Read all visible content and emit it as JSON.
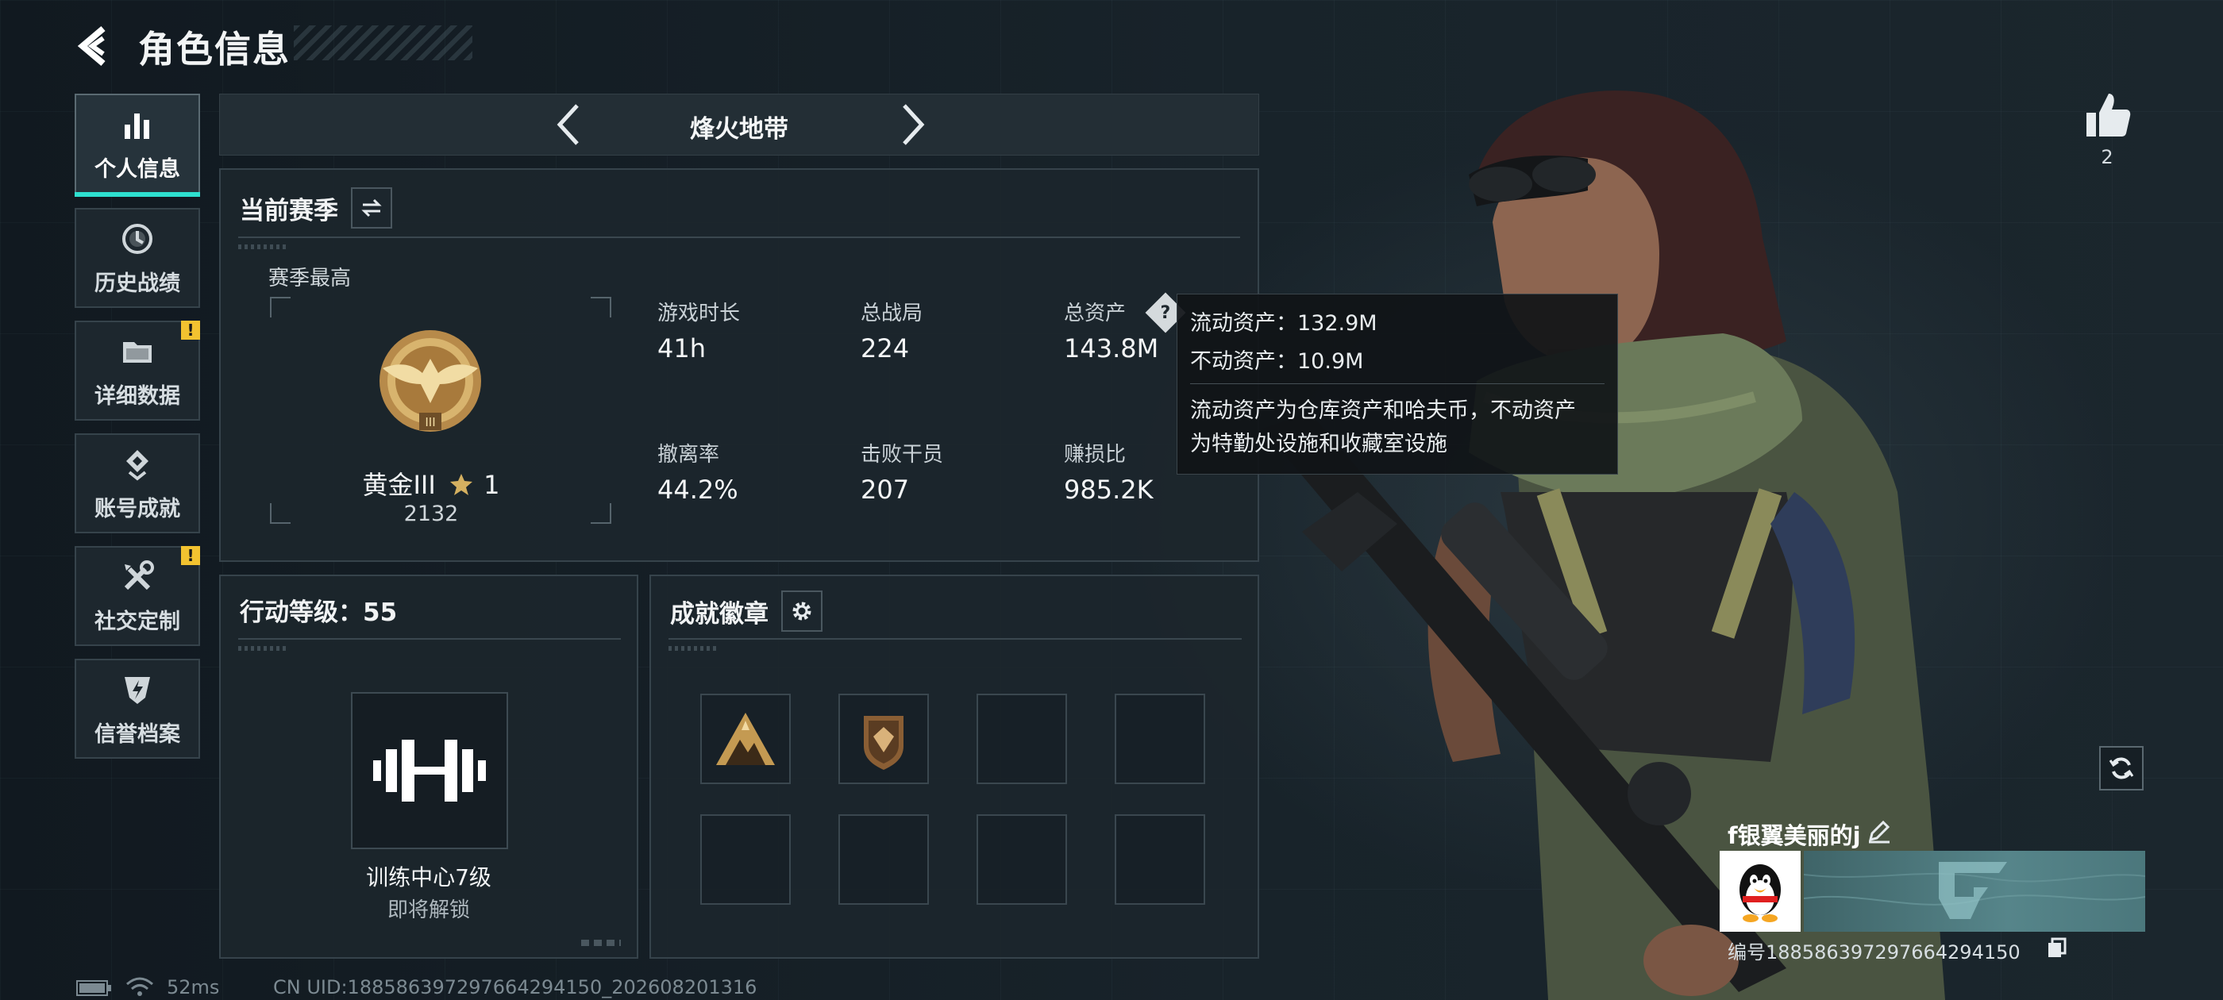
{
  "header": {
    "title": "角色信息",
    "back_icon": "back-arrow-icon"
  },
  "sidebar": {
    "items": [
      {
        "label": "个人信息",
        "icon": "bar-chart-icon",
        "active": true,
        "warning": false
      },
      {
        "label": "历史战绩",
        "icon": "history-clock-icon",
        "active": false,
        "warning": false
      },
      {
        "label": "详细数据",
        "icon": "folder-icon",
        "active": false,
        "warning": true,
        "warning_text": "!"
      },
      {
        "label": "账号成就",
        "icon": "achievement-icon",
        "active": false,
        "warning": false
      },
      {
        "label": "社交定制",
        "icon": "tools-icon",
        "active": false,
        "warning": true,
        "warning_text": "!"
      },
      {
        "label": "信誉档案",
        "icon": "shield-bolt-icon",
        "active": false,
        "warning": false
      }
    ]
  },
  "mode_bar": {
    "title": "烽火地带"
  },
  "season": {
    "title": "当前赛季",
    "subtitle": "赛季最高",
    "rank": {
      "name": "黄金III",
      "stars": "1",
      "score": "2132"
    },
    "stats": [
      {
        "label": "游戏时长",
        "value": "41h"
      },
      {
        "label": "总战局",
        "value": "224"
      },
      {
        "label": "总资产",
        "value": "143.8M"
      },
      {
        "label": "撤离率",
        "value": "44.2%"
      },
      {
        "label": "击败干员",
        "value": "207"
      },
      {
        "label": "赚损比",
        "value": "985.2K"
      }
    ],
    "help_label": "?"
  },
  "tooltip": {
    "liquid": "流动资产：132.9M",
    "fixed": "不动资产：10.9M",
    "note_line1": "流动资产为仓库资产和哈夫币，不动资产",
    "note_line2": "为特勤处设施和收藏室设施"
  },
  "action_level": {
    "title": "行动等级：55",
    "training_name": "训练中心7级",
    "training_status": "即将解锁"
  },
  "badges": {
    "title": "成就徽章",
    "settings_icon": "gear-icon"
  },
  "player": {
    "likes": "2",
    "name": "f银翼美丽的j",
    "id_text": "编号1885863972976642941​50"
  },
  "status_bar": {
    "ping": "52ms",
    "uid": "CN UID:188586397297664294150_202608201316"
  },
  "colors": {
    "accent": "#2ee0d0",
    "warning": "#f2c230",
    "gold": "#c9a45a"
  }
}
